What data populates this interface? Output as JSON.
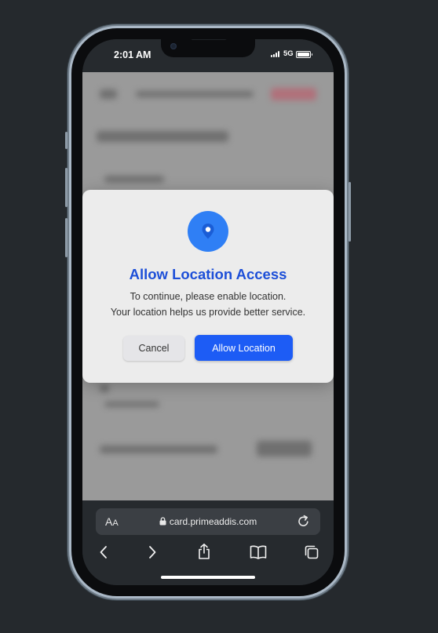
{
  "status_bar": {
    "time": "2:01 AM",
    "network": "5G"
  },
  "dialog": {
    "icon": "location-pin-icon",
    "title": "Allow Location Access",
    "message_line1": "To continue, please enable location.",
    "message_line2": "Your location helps us provide better service.",
    "cancel_label": "Cancel",
    "allow_label": "Allow Location"
  },
  "browser": {
    "text_size_label_big": "A",
    "text_size_label_small": "A",
    "url": "card.primeaddis.com",
    "icons": [
      "back-icon",
      "forward-icon",
      "share-icon",
      "bookmarks-icon",
      "tabs-icon",
      "reload-icon",
      "lock-icon"
    ]
  },
  "colors": {
    "accent": "#1d5cf5",
    "title": "#1d4fd8",
    "pin_circle": "#2f7ff5",
    "backdrop": "#25292d"
  }
}
